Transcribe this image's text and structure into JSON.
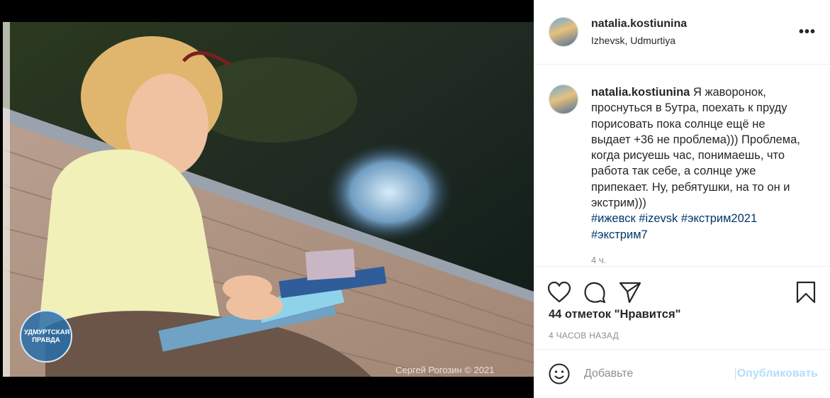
{
  "media": {
    "watermark_logo": "УДМУРТСКАЯ ПРАВДА",
    "photo_credit": "Сергей Рогозин © 2021"
  },
  "header": {
    "username": "natalia.kostiunina",
    "location": "Izhevsk, Udmurtiya",
    "more_label": "•••"
  },
  "caption": {
    "username": "natalia.kostiunina",
    "text": "Я жаворонок, проснуться в 5утра, поехать к пруду порисовать пока солнце ещё не выдает +36 не проблема))) Проблема, когда рисуешь час, понимаешь, что работа так себе, а солнце уже припекает. Ну, ребятушки, на то он и экстрим)))",
    "hashtags": [
      "#ижевск",
      "#izevsk",
      "#экстрим2021",
      "#экстрим7"
    ],
    "time": "4 ч."
  },
  "actions": {
    "icons": [
      "heart-icon",
      "comment-icon",
      "share-icon",
      "bookmark-icon"
    ]
  },
  "likes": "44 отметок \"Нравится\"",
  "posted_ago": "4 ЧАСОВ НАЗАД",
  "comment_box": {
    "placeholder": "Добавьте",
    "publish_label": "Опубликовать"
  },
  "colors": {
    "text": "#262626",
    "secondary": "#8e8e8e",
    "hashtag": "#00376b",
    "publish_disabled": "#b2dffc",
    "border": "#efefef"
  }
}
